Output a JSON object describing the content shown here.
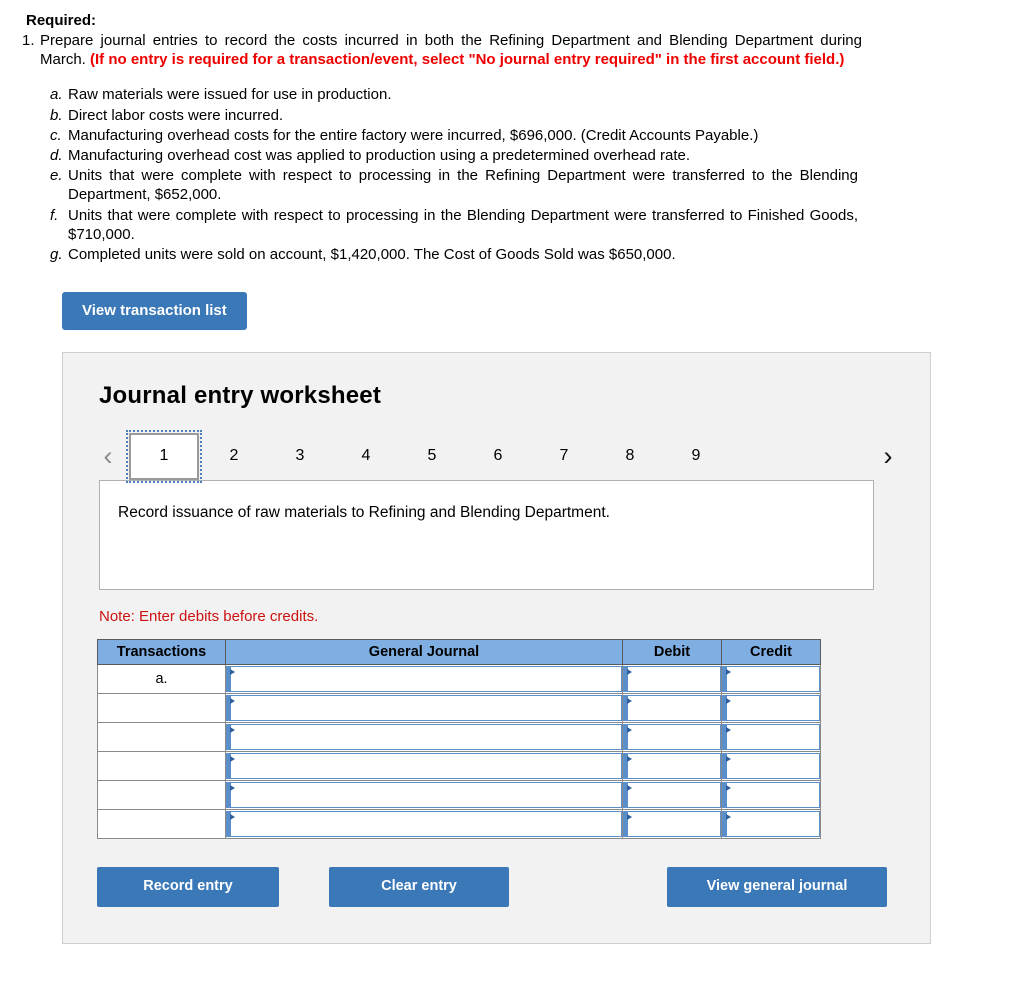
{
  "requirements": {
    "heading": "Required:",
    "item_number": "1.",
    "item_text_plain": "Prepare journal entries to record the costs incurred in both the Refining Department and Blending Department during March. ",
    "item_text_red": "(If no entry is required for a transaction/event, select \"No journal entry required\" in the first account field.)"
  },
  "transactions": [
    {
      "letter": "a.",
      "text": "Raw materials were issued for use in production."
    },
    {
      "letter": "b.",
      "text": "Direct labor costs were incurred."
    },
    {
      "letter": "c.",
      "text": "Manufacturing overhead costs for the entire factory were incurred, $696,000. (Credit Accounts Payable.)"
    },
    {
      "letter": "d.",
      "text": "Manufacturing overhead cost was applied to production using a predetermined overhead rate."
    },
    {
      "letter": "e.",
      "text": "Units that were complete with respect to processing in the Refining Department were transferred to the Blending Department, $652,000."
    },
    {
      "letter": "f.",
      "text": "Units that were complete with respect to processing in the Blending Department were transferred to Finished Goods, $710,000."
    },
    {
      "letter": "g.",
      "text": "Completed units were sold on account, $1,420,000. The Cost of Goods Sold was $650,000."
    }
  ],
  "view_transaction_list_label": "View transaction list",
  "worksheet": {
    "title": "Journal entry worksheet",
    "prev_icon": "chevron-left-icon",
    "next_icon": "chevron-right-icon",
    "prev_glyph": "‹",
    "next_glyph": "›",
    "tabs": [
      "1",
      "2",
      "3",
      "4",
      "5",
      "6",
      "7",
      "8",
      "9"
    ],
    "active_tab_index": 0,
    "description": "Record issuance of raw materials to Refining and Blending Department.",
    "note": "Note: Enter debits before credits.",
    "table": {
      "headers": [
        "Transactions",
        "General Journal",
        "Debit",
        "Credit"
      ],
      "rows": [
        {
          "transaction": "a.",
          "general_journal": "",
          "debit": "",
          "credit": ""
        },
        {
          "transaction": "",
          "general_journal": "",
          "debit": "",
          "credit": ""
        },
        {
          "transaction": "",
          "general_journal": "",
          "debit": "",
          "credit": ""
        },
        {
          "transaction": "",
          "general_journal": "",
          "debit": "",
          "credit": ""
        },
        {
          "transaction": "",
          "general_journal": "",
          "debit": "",
          "credit": ""
        },
        {
          "transaction": "",
          "general_journal": "",
          "debit": "",
          "credit": ""
        }
      ]
    },
    "buttons": {
      "record": "Record entry",
      "clear": "Clear entry",
      "view_journal": "View general journal"
    }
  },
  "colors": {
    "button_blue": "#3b78b8",
    "table_header_blue": "#7eaee2",
    "note_red": "#cc1111",
    "instruction_red": "#ee0000",
    "panel_background": "#f2f2f2",
    "cell_border_blue": "#5b8fc9"
  }
}
